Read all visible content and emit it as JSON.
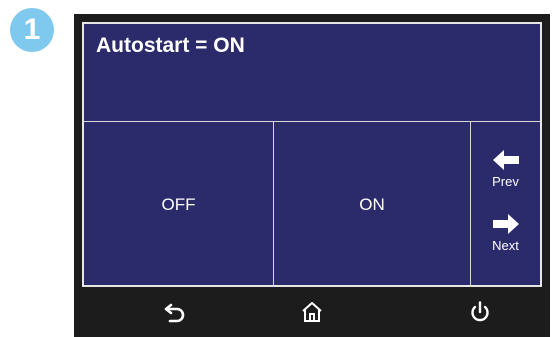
{
  "step": {
    "number": "1"
  },
  "screen": {
    "title": "Autostart = ON",
    "options": {
      "off_label": "OFF",
      "on_label": "ON"
    },
    "nav": {
      "prev_label": "Prev",
      "next_label": "Next"
    }
  },
  "bottom_bar": {
    "icons": [
      "back-icon",
      "home-icon",
      "power-icon"
    ]
  },
  "colors": {
    "screen_bg": "#2b2a6b",
    "device_bezel": "#1c1c1c",
    "badge": "#7fc8ee",
    "text": "#ffffff"
  }
}
